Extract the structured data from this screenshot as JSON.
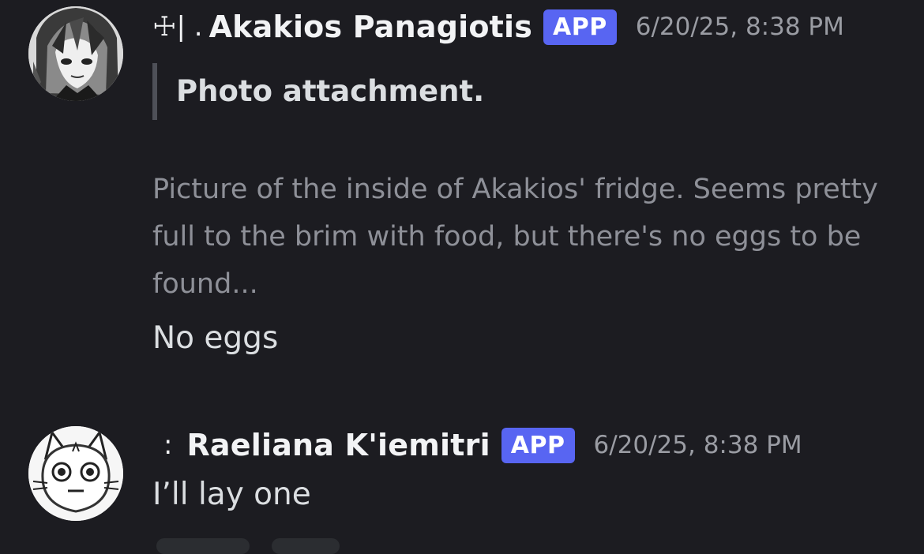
{
  "messages": [
    {
      "avatar_icon": "anime-character-avatar",
      "name_prefix": "☩| .",
      "username": "Akakios Panagiotis",
      "badge": "APP",
      "timestamp": "6/20/25, 8:38 PM",
      "quote_title": "Photo attachment.",
      "description": "Picture of the inside of Akakios' fridge. Seems pretty full to the brim with food, but there's no eggs to be found...",
      "content": "No eggs"
    },
    {
      "avatar_icon": "cat-face-avatar",
      "name_prefix": "꞉",
      "username": "Raeliana K'iemitri",
      "badge": "APP",
      "timestamp": "6/20/25, 8:38 PM",
      "content": "I’ll lay one"
    }
  ],
  "colors": {
    "background": "#1c1c21",
    "badge": "#5865f2",
    "username": "#f2f3f5",
    "timestamp": "#9a9ca3",
    "description": "#8e9098",
    "quote_bar": "#4e5058"
  }
}
